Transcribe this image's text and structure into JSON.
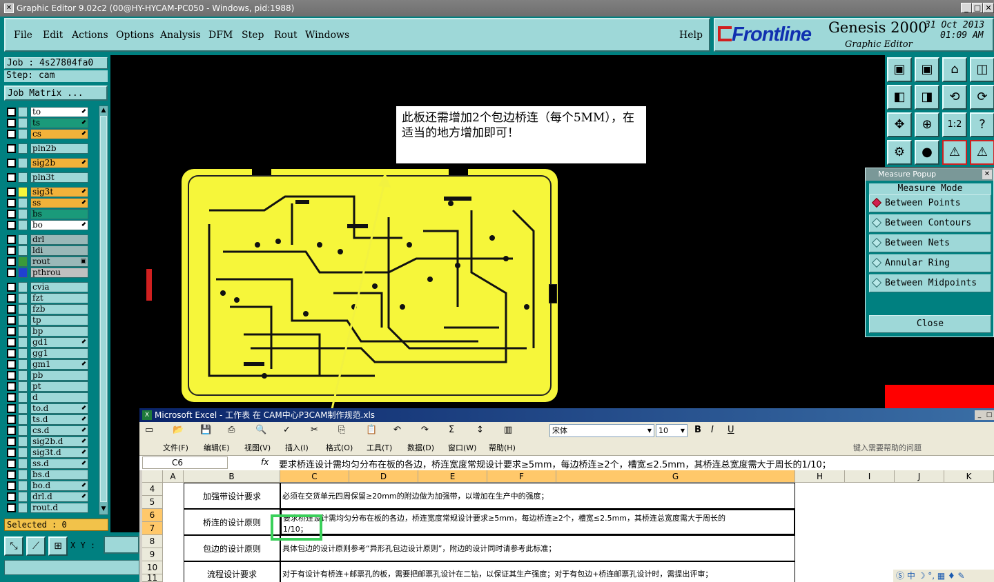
{
  "window": {
    "title": "Graphic Editor 9.02c2 (00@HY-HYCAM-PC050 - Windows, pid:1988)"
  },
  "menu": {
    "items": [
      "File",
      "Edit",
      "Actions",
      "Options",
      "Analysis",
      "DFM",
      "Step",
      "Rout",
      "Windows"
    ],
    "help": "Help"
  },
  "brand": {
    "logo": "Frontline",
    "product": "Genesis 2000",
    "subtitle": "Graphic Editor",
    "date": "31 Oct 2013",
    "time": "01:09 AM"
  },
  "job": {
    "job_label": "Job : 4s27804fa0",
    "step_label": "Step: cam",
    "matrix_button": "Job Matrix ..."
  },
  "layers": [
    {
      "name": "to",
      "color": "#ffffff",
      "mark": "⬋"
    },
    {
      "name": "ts",
      "color": "#1a9a7a",
      "mark": "⬋"
    },
    {
      "name": "cs",
      "color": "#f2b23a",
      "mark": "⬋"
    },
    {
      "name": "pln2b",
      "color": "#9ed8d8",
      "mark": ""
    },
    {
      "name": "sig2b",
      "color": "#f2b23a",
      "mark": "⬋"
    },
    {
      "name": "pln3t",
      "color": "#9ed8d8",
      "mark": ""
    },
    {
      "name": "sig3t",
      "color": "#f2b23a",
      "mark": "⬋"
    },
    {
      "name": "ss",
      "color": "#f2b23a",
      "mark": "⬋"
    },
    {
      "name": "bs",
      "color": "#1a9a7a",
      "mark": ""
    },
    {
      "name": "bo",
      "color": "#ffffff",
      "mark": "⬋"
    },
    {
      "name": "drl",
      "color": "#9ab8b8",
      "mark": ""
    },
    {
      "name": "ldi",
      "color": "#9ab8b8",
      "mark": ""
    },
    {
      "name": "rout",
      "color": "#9ab8b8",
      "mark": "▣"
    },
    {
      "name": "pthrou",
      "color": "#c0c0c0",
      "mark": ""
    },
    {
      "name": "cvia",
      "color": "#9ed8d8",
      "mark": ""
    },
    {
      "name": "fzt",
      "color": "#9ed8d8",
      "mark": ""
    },
    {
      "name": "fzb",
      "color": "#9ed8d8",
      "mark": ""
    },
    {
      "name": "tp",
      "color": "#9ed8d8",
      "mark": ""
    },
    {
      "name": "bp",
      "color": "#9ed8d8",
      "mark": ""
    },
    {
      "name": "gd1",
      "color": "#9ed8d8",
      "mark": "⬋"
    },
    {
      "name": "gg1",
      "color": "#9ed8d8",
      "mark": ""
    },
    {
      "name": "gm1",
      "color": "#9ed8d8",
      "mark": "⬋"
    },
    {
      "name": "pb",
      "color": "#9ed8d8",
      "mark": ""
    },
    {
      "name": "pt",
      "color": "#9ed8d8",
      "mark": ""
    },
    {
      "name": "d",
      "color": "#9ed8d8",
      "mark": ""
    },
    {
      "name": "to.d",
      "color": "#9ed8d8",
      "mark": "⬋"
    },
    {
      "name": "ts.d",
      "color": "#9ed8d8",
      "mark": "⬋"
    },
    {
      "name": "cs.d",
      "color": "#9ed8d8",
      "mark": "⬋"
    },
    {
      "name": "sig2b.d",
      "color": "#9ed8d8",
      "mark": "⬋"
    },
    {
      "name": "sig3t.d",
      "color": "#9ed8d8",
      "mark": "⬋"
    },
    {
      "name": "ss.d",
      "color": "#9ed8d8",
      "mark": "⬋"
    },
    {
      "name": "bs.d",
      "color": "#9ed8d8",
      "mark": ""
    },
    {
      "name": "bo.d",
      "color": "#9ed8d8",
      "mark": "⬋"
    },
    {
      "name": "drl.d",
      "color": "#9ed8d8",
      "mark": "⬋"
    },
    {
      "name": "rout.d",
      "color": "#9ed8d8",
      "mark": ""
    }
  ],
  "status": {
    "selected": "Selected : 0",
    "xy_label": "X Y :"
  },
  "note": {
    "text": "此板还需增加2个包边桥连（每个5MM），在适当的地方增加即可！"
  },
  "measure": {
    "title": "Measure Popup",
    "mode_label": "Measure Mode",
    "options": [
      "Between Points",
      "Between Contours",
      "Between Nets",
      "Annular Ring",
      "Between Midpoints"
    ],
    "close": "Close"
  },
  "icon_buttons": [
    "▣",
    "▣",
    "⌂",
    "◫",
    "◧",
    "◨",
    "⟲",
    "⟳",
    "✥",
    "⊕",
    "1:2",
    "?",
    "⚙",
    "●",
    "⚠",
    "⚠"
  ],
  "excel": {
    "title": "Microsoft Excel - 工作表 在 CAM中心P3CAM制作规范.xls",
    "font": "宋体",
    "size": "10",
    "menus": [
      "文件(F)",
      "编辑(E)",
      "视图(V)",
      "插入(I)",
      "格式(O)",
      "工具(T)",
      "数据(D)",
      "窗口(W)",
      "帮助(H)"
    ],
    "help_placeholder": "键入需要帮助的问题",
    "name_box": "C6",
    "formula": "要求桥连设计需均匀分布在板的各边，桥连宽度常规设计要求≥5mm，每边桥连≥2个，槽宽≤2.5mm，其桥连总宽度需大于周长的1/10；",
    "columns": [
      "A",
      "B",
      "C",
      "D",
      "E",
      "F",
      "G",
      "H",
      "I",
      "J",
      "K"
    ],
    "rows": [
      {
        "nums": [
          "4",
          "5"
        ],
        "b": "加强带设计要求",
        "c": "必须在交货单元四周保留≥20mm的附边做为加强带，以增加在生产中的强度；"
      },
      {
        "nums": [
          "6",
          "7"
        ],
        "b": "桥连的设计原则",
        "c": "要求桥连设计需均匀分布在板的各边，桥连宽度常规设计要求≥5mm，每边桥连≥2个，槽宽≤2.5mm，其桥连总宽度需大于周长的",
        "c2": "1/10；"
      },
      {
        "nums": [
          "8",
          "9"
        ],
        "b": "包边的设计原则",
        "c": "具体包边的设计原则参考“异形孔包边设计原则”，附边的设计同时请参考此标准；"
      },
      {
        "nums": [
          "10",
          "11"
        ],
        "b": "流程设计要求",
        "c": "对于有设计有桥连+邮票孔的板，需要把邮票孔设计在二钻，以保证其生产强度；对于有包边+桥连邮票孔设计时，需提出评审；"
      }
    ]
  }
}
